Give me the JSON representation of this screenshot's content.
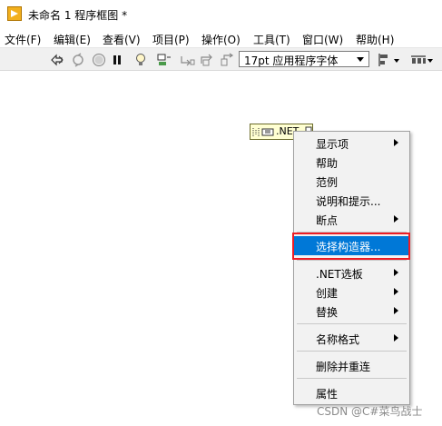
{
  "window": {
    "title": "未命名 1 程序框图 *"
  },
  "menu": [
    "文件(F)",
    "编辑(E)",
    "查看(V)",
    "项目(P)",
    "操作(O)",
    "工具(T)",
    "窗口(W)",
    "帮助(H)"
  ],
  "toolbar": {
    "icons": [
      "run-continuously-icon",
      "retain-wire-values-icon",
      "abort-icon",
      "pause-icon",
      "highlight-execution-icon",
      "probe-icon",
      "step-into-icon",
      "step-over-icon",
      "step-out-icon"
    ],
    "font_select": "17pt 应用程序字体"
  },
  "node": {
    "label": ".NET"
  },
  "context_menu": {
    "items": [
      {
        "label": "显示项",
        "submenu": true
      },
      {
        "label": "帮助",
        "submenu": false
      },
      {
        "label": "范例",
        "submenu": false
      },
      {
        "label": "说明和提示...",
        "submenu": false
      },
      {
        "label": "断点",
        "submenu": true
      },
      {
        "label": "选择构造器...",
        "submenu": false,
        "selected": true
      },
      {
        "label": ".NET选板",
        "submenu": true
      },
      {
        "label": "创建",
        "submenu": true
      },
      {
        "label": "替换",
        "submenu": true
      },
      {
        "label": "名称格式",
        "submenu": true
      },
      {
        "label": "删除并重连",
        "submenu": false
      },
      {
        "label": "属性",
        "submenu": false
      }
    ]
  },
  "colors": {
    "selection": "#0078d7",
    "highlight_box": "#ee1c24",
    "node_fill": "#ffffd2"
  },
  "watermark": "CSDN @C#菜鸟战士"
}
